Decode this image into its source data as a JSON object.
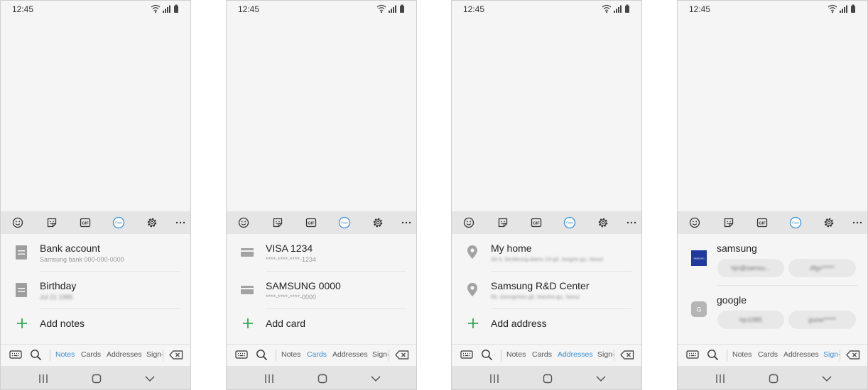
{
  "status": {
    "time": "12:45"
  },
  "toolbar": {
    "pass_label": "Pass",
    "gif_label": "GIF"
  },
  "tabs": {
    "notes": "Notes",
    "cards": "Cards",
    "addresses": "Addresses",
    "sign": "Sign-"
  },
  "colors": {
    "accent": "#3b8ed4",
    "add_green": "#2eaa4f",
    "samsung_logo": "#1f3a9c"
  },
  "screens": [
    {
      "active_tab": "Notes",
      "items": [
        {
          "title": "Bank account",
          "subtitle": "Samsung bank 000-000-0000",
          "icon": "note-icon"
        },
        {
          "title": "Birthday",
          "subtitle": "Jul 21 1985",
          "icon": "note-icon"
        }
      ],
      "add_label": "Add notes"
    },
    {
      "active_tab": "Cards",
      "items": [
        {
          "title": "VISA 1234",
          "subtitle": "****-****-****-1234",
          "icon": "card-icon"
        },
        {
          "title": "SAMSUNG 0000",
          "subtitle": "****-****-****-0000",
          "icon": "card-icon"
        }
      ],
      "add_label": "Add card"
    },
    {
      "active_tab": "Addresses",
      "items": [
        {
          "title": "My home",
          "subtitle": "20-3, Seolleung-daero 23-gil, Jongno-gu, Seoul",
          "icon": "location-pin-icon"
        },
        {
          "title": "Samsung R&D Center",
          "subtitle": "56, Seongchon-gil, Seocho-gu, Seoul",
          "icon": "location-pin-icon"
        }
      ],
      "add_label": "Add address"
    },
    {
      "active_tab": "Sign-",
      "accounts": [
        {
          "name": "samsung",
          "logo_text": "SAMSUNG",
          "username": "hjn@samsu...",
          "password": "dfgv*****"
        },
        {
          "name": "google",
          "logo_text": "G",
          "username": "hjn1985",
          "password": "guow*****"
        }
      ]
    }
  ]
}
